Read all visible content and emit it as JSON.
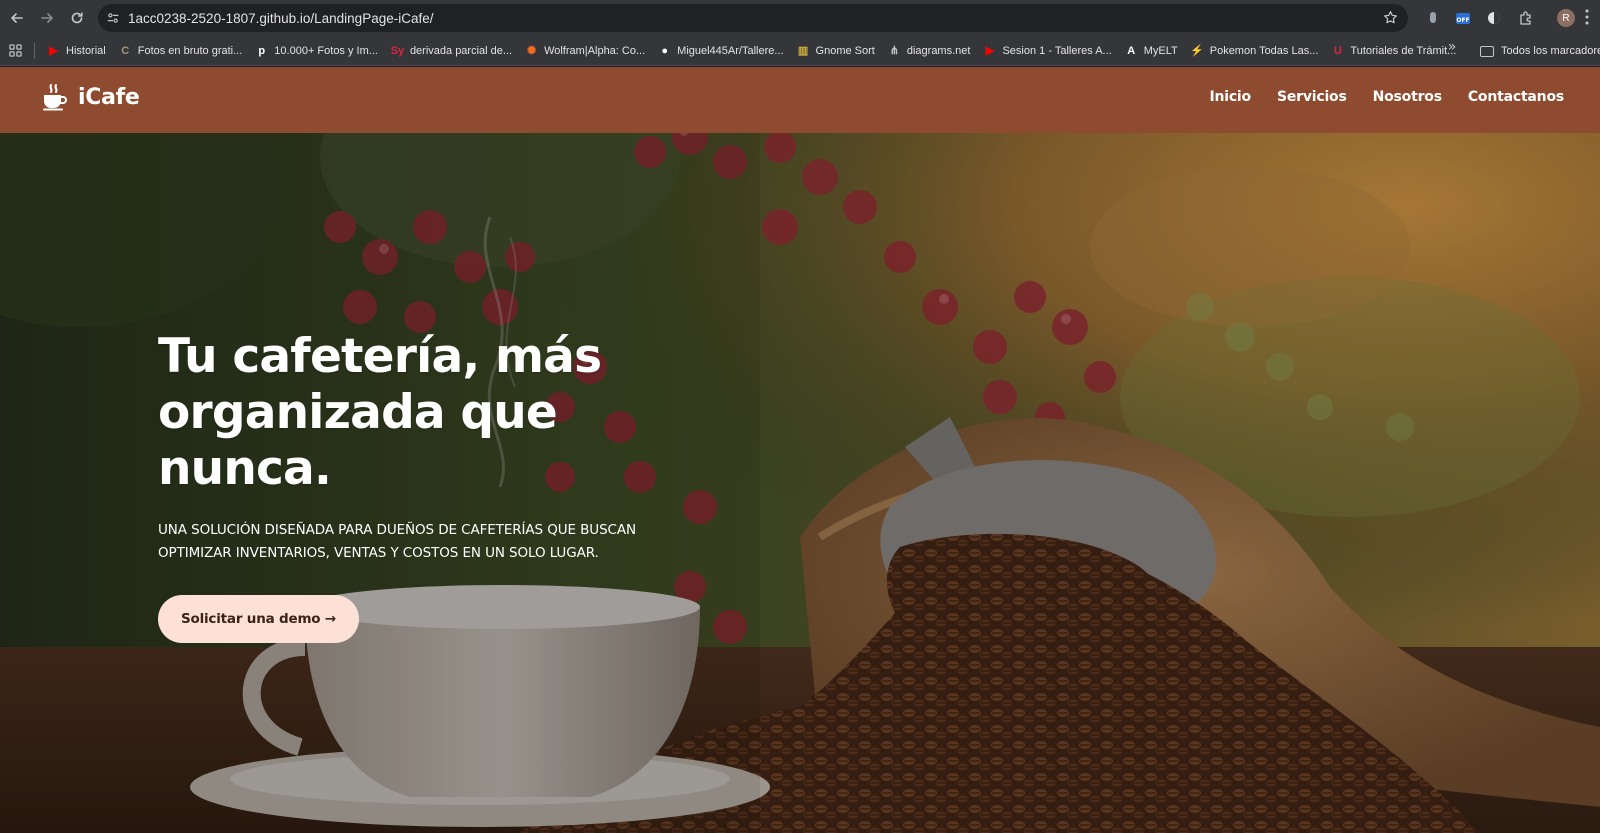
{
  "browser": {
    "url": "1acc0238-2520-1807.github.io/LandingPage-iCafe/",
    "bookmarks": [
      {
        "label": "Historial",
        "icon": "youtube-icon",
        "color": "#ff0000"
      },
      {
        "label": "Fotos en bruto grati...",
        "icon": "rawpixel-icon",
        "color": "#a89274"
      },
      {
        "label": "10.000+ Fotos y Im...",
        "icon": "pixabay-icon",
        "color": "#ffffff"
      },
      {
        "label": "derivada parcial de...",
        "icon": "symbolab-icon",
        "color": "#d7263d"
      },
      {
        "label": "Wolfram|Alpha: Co...",
        "icon": "wolfram-icon",
        "color": "#f36b21"
      },
      {
        "label": "Miguel445Ar/Tallere...",
        "icon": "github-icon",
        "color": "#ffffff"
      },
      {
        "label": "Gnome Sort",
        "icon": "gnome-sort-icon",
        "color": "#d4b13b"
      },
      {
        "label": "diagrams.net",
        "icon": "diagrams-icon",
        "color": "#c4c7c5"
      },
      {
        "label": "Sesion 1 - Talleres A...",
        "icon": "youtube-icon",
        "color": "#ff0000"
      },
      {
        "label": "MyELT",
        "icon": "myelt-icon",
        "color": "#ffffff"
      },
      {
        "label": "Pokemon Todas Las...",
        "icon": "pokemon-icon",
        "color": "#f6c12b"
      },
      {
        "label": "Tutoriales de Trámit...",
        "icon": "university-icon",
        "color": "#d7263d"
      }
    ],
    "all_bookmarks_label": "Todos los marcadores",
    "avatar_initial": "R"
  },
  "site": {
    "brand": "iCafe",
    "nav": [
      "Inicio",
      "Servicios",
      "Nosotros",
      "Contactanos"
    ],
    "hero_title": "Tu cafetería, más organizada que nunca.",
    "hero_subtitle": "UNA SOLUCIÓN DISEÑADA PARA DUEÑOS DE CAFETERÍAS QUE BUSCAN OPTIMIZAR INVENTARIOS, VENTAS Y COSTOS EN UN SOLO LUGAR.",
    "cta_label": "Solicitar una demo →",
    "colors": {
      "header": "#8f4b30",
      "cta": "#fde1d7"
    }
  }
}
